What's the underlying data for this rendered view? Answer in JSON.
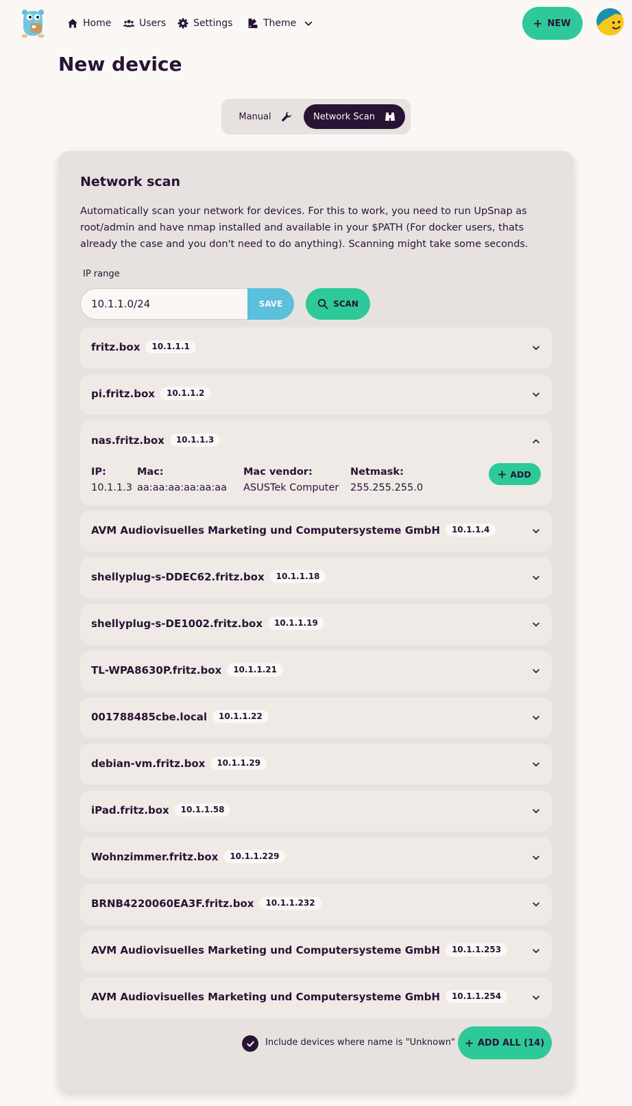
{
  "nav": {
    "home": "Home",
    "users": "Users",
    "settings": "Settings",
    "theme": "Theme",
    "new_button": "NEW"
  },
  "page": {
    "title": "New device"
  },
  "mode_toggle": {
    "manual": "Manual",
    "network_scan": "Network Scan",
    "active": "Network Scan"
  },
  "scan_card": {
    "title": "Network scan",
    "description": "Automatically scan your network for devices. For this to work, you need to run UpSnap as root/admin and have nmap installed and available in your $PATH (For docker users, thats already the case and you don't need to do anything). Scanning might take some seconds.",
    "ip_range_label": "IP range",
    "ip_range_value": "10.1.1.0/24",
    "save_label": "SAVE",
    "scan_label": "SCAN"
  },
  "devices": [
    {
      "name": "fritz.box",
      "ip": "10.1.1.1"
    },
    {
      "name": "pi.fritz.box",
      "ip": "10.1.1.2"
    },
    {
      "name": "nas.fritz.box",
      "ip": "10.1.1.3"
    },
    {
      "name": "AVM Audiovisuelles Marketing und Computersysteme GmbH",
      "ip": "10.1.1.4"
    },
    {
      "name": "shellyplug-s-DDEC62.fritz.box",
      "ip": "10.1.1.18"
    },
    {
      "name": "shellyplug-s-DE1002.fritz.box",
      "ip": "10.1.1.19"
    },
    {
      "name": "TL-WPA8630P.fritz.box",
      "ip": "10.1.1.21"
    },
    {
      "name": "001788485cbe.local",
      "ip": "10.1.1.22"
    },
    {
      "name": "debian-vm.fritz.box",
      "ip": "10.1.1.29"
    },
    {
      "name": "iPad.fritz.box",
      "ip": "10.1.1.58"
    },
    {
      "name": "Wohnzimmer.fritz.box",
      "ip": "10.1.1.229"
    },
    {
      "name": "BRNB4220060EA3F.fritz.box",
      "ip": "10.1.1.232"
    },
    {
      "name": "AVM Audiovisuelles Marketing und Computersysteme GmbH",
      "ip": "10.1.1.253"
    },
    {
      "name": "AVM Audiovisuelles Marketing und Computersysteme GmbH",
      "ip": "10.1.1.254"
    }
  ],
  "expanded_device": {
    "ip_label": "IP:",
    "ip": "10.1.1.3",
    "mac_label": "Mac:",
    "mac": "aa:aa:aa:aa:aa:aa",
    "vendor_label": "Mac vendor:",
    "vendor": "ASUSTek Computer",
    "netmask_label": "Netmask:",
    "netmask": "255.255.255.0",
    "add_label": "ADD"
  },
  "footer": {
    "include_unknown_label": "Include devices where name is \"Unknown\"",
    "include_unknown_checked": true,
    "add_all_label": "ADD ALL (14)"
  },
  "colors": {
    "primary": "#2ec999",
    "secondary": "#5ac0db",
    "neutral": "#291334",
    "base": "#faf7f5",
    "card": "#e7e2df"
  }
}
